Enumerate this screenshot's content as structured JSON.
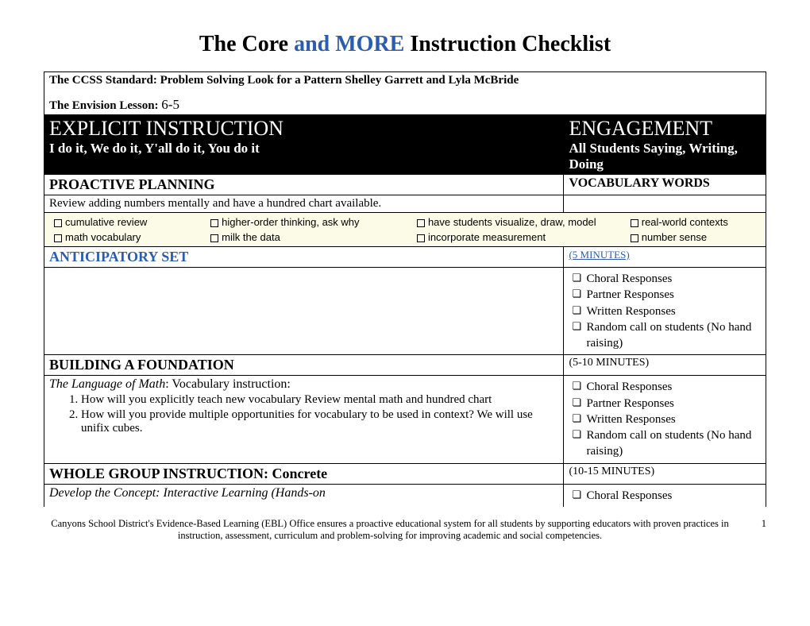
{
  "title": {
    "part1": "The Core ",
    "part2": "and MORE ",
    "part3": "Instruction Checklist"
  },
  "standard": "The CCSS Standard: Problem Solving Look for a Pattern    Shelley Garrett and Lyla McBride",
  "lesson_label": "The Envision Lesson: ",
  "lesson_num": "6-5",
  "explicit": {
    "heading": "EXPLICIT INSTRUCTION",
    "sub": "I do it, We do it, Y'all do it, You do it"
  },
  "engagement": {
    "heading": "ENGAGEMENT",
    "sub": "All Students Saying, Writing, Doing"
  },
  "proactive": {
    "title": "PROACTIVE PLANNING",
    "vocab": "VOCABULARY WORDS",
    "text": "Review adding numbers mentally and have a hundred chart available."
  },
  "checkboxes": {
    "r1c1": "cumulative review",
    "r1c2": "higher-order thinking, ask why",
    "r1c3": "have students visualize, draw, model",
    "r1c4": "real-world contexts",
    "r2c1": "math vocabulary",
    "r2c2": "milk the data",
    "r2c3": "incorporate measurement",
    "r2c4": "number sense"
  },
  "anticipatory": {
    "title": "ANTICIPATORY SET",
    "time": "(5 MINUTES)"
  },
  "responses": {
    "choral": "Choral Responses",
    "partner": "Partner Responses",
    "written": "Written Responses",
    "random": "Random call on students (No hand raising)"
  },
  "foundation": {
    "title": "BUILDING A FOUNDATION",
    "time": "(5-10 MINUTES)",
    "lead": "The Language of Math",
    "lead2": ": Vocabulary instruction:",
    "q1": "How will you explicitly teach new vocabulary Review mental math and hundred chart",
    "q2": "How will you provide multiple opportunities for vocabulary to be used in context? We will use unifix cubes."
  },
  "wholegroup": {
    "title": "WHOLE GROUP INSTRUCTION:  Concrete",
    "time": "(10-15 MINUTES)",
    "sub": "Develop the Concept: Interactive Learning (Hands-on"
  },
  "footer": {
    "text": "Canyons School District's Evidence-Based Learning (EBL) Office ensures a proactive educational system for all students by supporting educators with proven practices in instruction, assessment, curriculum and problem-solving for improving academic and social competencies.",
    "page": "1"
  }
}
